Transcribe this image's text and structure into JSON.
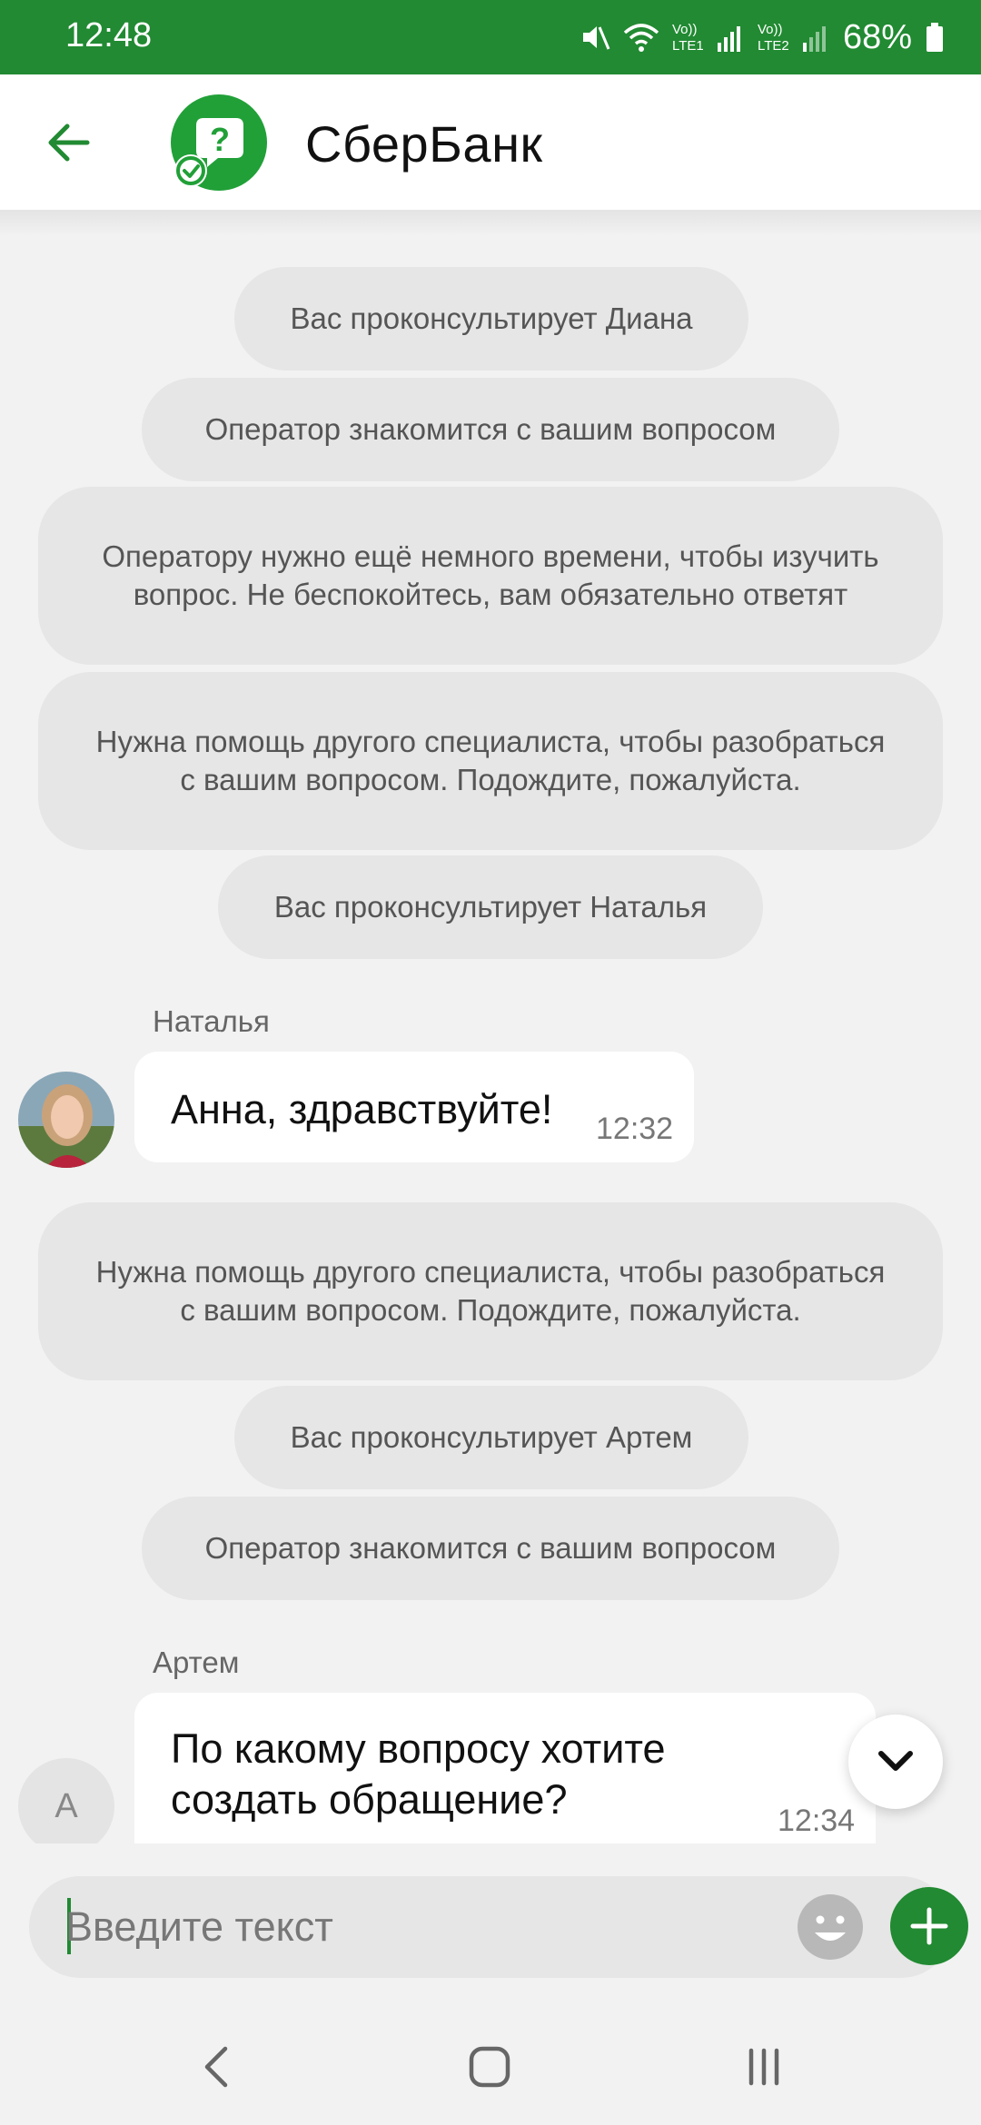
{
  "status_bar": {
    "time": "12:48",
    "battery": "68%",
    "sim1": "LTE1",
    "sim2": "LTE2",
    "volte": "Vo))",
    "icons": [
      "mute-icon",
      "wifi-icon",
      "signal-icon",
      "battery-icon"
    ]
  },
  "header": {
    "title": "СберБанк",
    "back_icon": "arrow-left-icon",
    "logo_icon": "help-chat-logo-icon"
  },
  "messages": {
    "sys1": "Вас проконсультирует Диана",
    "sys2": "Оператор знакомится с вашим вопросом",
    "sys3": "Оператору нужно ещё немного времени, чтобы изучить вопрос. Не беспокойтесь, вам обязательно ответят",
    "sys4": "Нужна помощь другого специалиста, чтобы разобраться с вашим вопросом. Подождите, пожалуйста.",
    "sys5": "Вас проконсультирует Наталья",
    "natalia_name": "Наталья",
    "natalia_text": "Анна, здравствуйте!",
    "natalia_time": "12:32",
    "sys6": "Нужна помощь другого специалиста, чтобы разобраться с вашим вопросом. Подождите, пожалуйста.",
    "sys7": "Вас проконсультирует Артем",
    "sys8": "Оператор знакомится с вашим вопросом",
    "artem_name": "Артем",
    "artem_avatar_letter": "А",
    "artem_text": "По какому вопросу хотите создать обращение?",
    "artem_time": "12:34"
  },
  "input": {
    "placeholder": "Введите текст",
    "value": ""
  },
  "colors": {
    "brand": "#218a32",
    "bubble": "#ffffff",
    "system_bubble": "#e6e6e6",
    "background": "#f2f2f2"
  }
}
